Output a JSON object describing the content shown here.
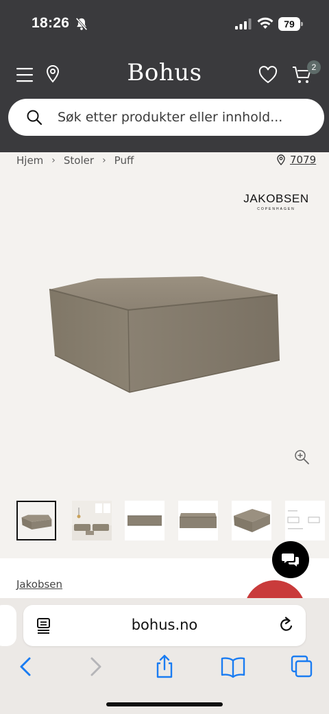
{
  "status_bar": {
    "time": "18:26",
    "battery": "79"
  },
  "header": {
    "logo": "Bohus",
    "cart_count": "2"
  },
  "search": {
    "placeholder": "Søk etter produkter eller innhold..."
  },
  "breadcrumb": {
    "items": [
      "Hjem",
      "Stoler",
      "Puff"
    ],
    "store_code": "7079"
  },
  "brand": {
    "name": "JAKOBSEN",
    "sub": "COPENHAGEN"
  },
  "product": {
    "brand_link": "Jakobsen"
  },
  "browser": {
    "url": "bohus.no"
  },
  "colors": {
    "header_bg": "#3a3a3d",
    "page_bg": "#f4f2ef",
    "fabric": "#8a8071",
    "badge": "#5e6b69",
    "safari_blue": "#1a7cf2"
  },
  "icons": [
    "bell-slash-icon",
    "signal-icon",
    "wifi-icon",
    "menu-icon",
    "location-icon",
    "heart-icon",
    "cart-icon",
    "search-icon",
    "pin-icon",
    "zoom-in-icon",
    "chat-icon",
    "reader-icon",
    "reload-icon",
    "back-icon",
    "forward-icon",
    "share-icon",
    "bookmarks-icon",
    "tabs-icon"
  ]
}
